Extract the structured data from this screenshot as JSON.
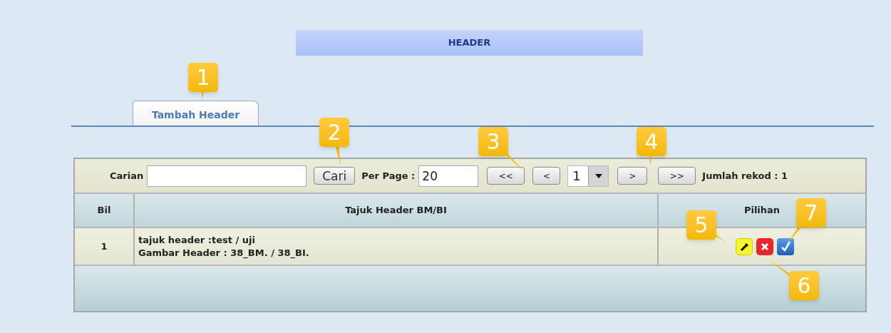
{
  "title": "HEADER",
  "tabs": [
    {
      "label": "Tambah Header",
      "selected": true
    }
  ],
  "toolbar": {
    "search_label": "Carian",
    "search_button": "Cari",
    "per_page_label": "Per Page :",
    "per_page_value": "20",
    "first_button": "<<",
    "prev_button": "<",
    "page_value": "1",
    "next_button": ">",
    "last_button": ">>",
    "record_count": "Jumlah rekod : 1"
  },
  "table": {
    "columns": [
      "Bil",
      "Tajuk Header BM/BI",
      "Pilihan"
    ],
    "rows": [
      {
        "number": "1",
        "lines": [
          "tajuk header :test / uji",
          "Gambar Header : 38_BM. / 38_BI."
        ],
        "actions": [
          {
            "kind": "edit"
          },
          {
            "kind": "delete"
          },
          {
            "kind": "approve"
          }
        ]
      }
    ]
  },
  "callouts": [
    {
      "label": "1"
    },
    {
      "label": "2"
    },
    {
      "label": "3"
    },
    {
      "label": "4"
    },
    {
      "label": "5"
    },
    {
      "label": "6"
    },
    {
      "label": "7"
    }
  ]
}
